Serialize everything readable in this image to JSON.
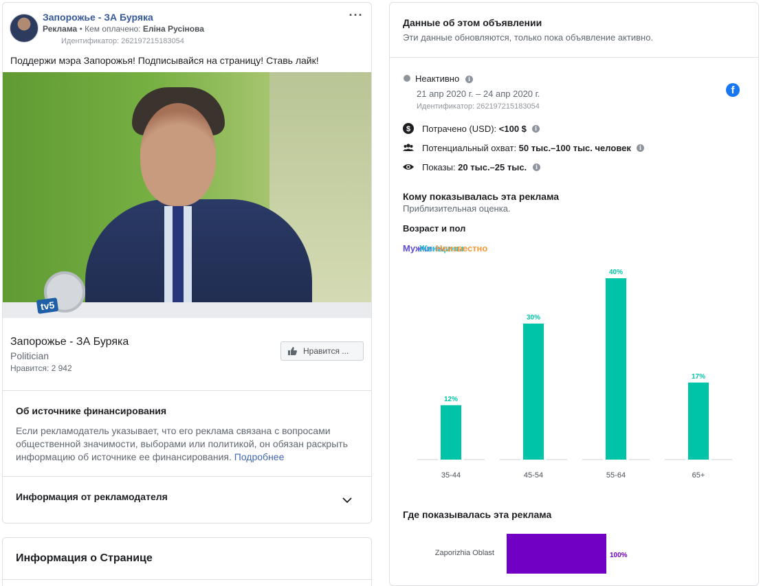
{
  "ad": {
    "page_name": "Запорожье - ЗА Буряка",
    "sponsored_label": "Реклама",
    "paid_by_label": " • Кем оплачено: ",
    "payer": "Еліна Русінова",
    "id_line": "Идентификатор: 262197215183054",
    "text": "Поддержи мэра Запорожья! Подписывайся на страницу! Ставь лайк!",
    "image_logo": "tv5",
    "page_row": {
      "name": "Запорожье - ЗА Буряка",
      "category": "Politician",
      "likes": "Нравится: 2 942",
      "like_button_label": "Нравится ..."
    },
    "funding": {
      "title": "Об источнике финансирования",
      "text": "Если рекламодатель указывает, что его реклама связана с вопросами общественной значимости, выборами или политикой, он обязан раскрыть информацию об источнике ее финансирования.",
      "more_link": "Подробнее"
    },
    "advertiser_info_title": "Информация от рекламодателя"
  },
  "page_info": {
    "title": "Информация о Странице"
  },
  "data": {
    "title": "Данные об этом объявлении",
    "subtitle": "Эти данные обновляются, только пока объявление активно.",
    "status": "Неактивно",
    "dates": "21 апр 2020 г. – 24 апр 2020 г.",
    "id_line": "Идентификатор: 262197215183054",
    "platform_icon": "facebook-icon",
    "spent_label": "Потрачено (USD): ",
    "spent_value": "<100 $",
    "reach_label": "Потенциальный охват: ",
    "reach_value": "50 тыс.–100 тыс. человек",
    "impressions_label": "Показы: ",
    "impressions_value": "20 тыс.–25 тыс.",
    "who_title": "Кому показывалась эта реклама",
    "who_subtitle": "Приблизительная оценка.",
    "age_gender_title": "Возраст и пол",
    "legend": [
      {
        "label": "Мужчины",
        "color": "#5b4bd4"
      },
      {
        "label": "Женщины",
        "color": "#21bfd6"
      },
      {
        "label": "Неизвестно",
        "color": "#f29a3a"
      }
    ],
    "where_title": "Где показывалась эта реклама"
  },
  "colors": {
    "link": "#365899",
    "bar_primary": "#00c4a7",
    "region_bar": "#7100c4"
  },
  "chart_data": [
    {
      "type": "bar",
      "title": "Возраст и пол",
      "categories": [
        "35-44",
        "45-54",
        "55-64",
        "65+"
      ],
      "series": [
        {
          "name": "Мужчины",
          "values": [
            0,
            0,
            0,
            0
          ]
        },
        {
          "name": "Женщины",
          "values": [
            12,
            30,
            40,
            17
          ]
        },
        {
          "name": "Неизвестно",
          "values": [
            0,
            0,
            0,
            0
          ]
        }
      ],
      "value_labels": [
        "12%",
        "30%",
        "40%",
        "17%"
      ],
      "ylim": [
        0,
        40
      ]
    },
    {
      "type": "bar",
      "title": "Где показывалась эта реклама",
      "categories": [
        "Zaporizhia Oblast"
      ],
      "values": [
        100
      ],
      "value_labels": [
        "100%"
      ],
      "orientation": "horizontal"
    }
  ]
}
